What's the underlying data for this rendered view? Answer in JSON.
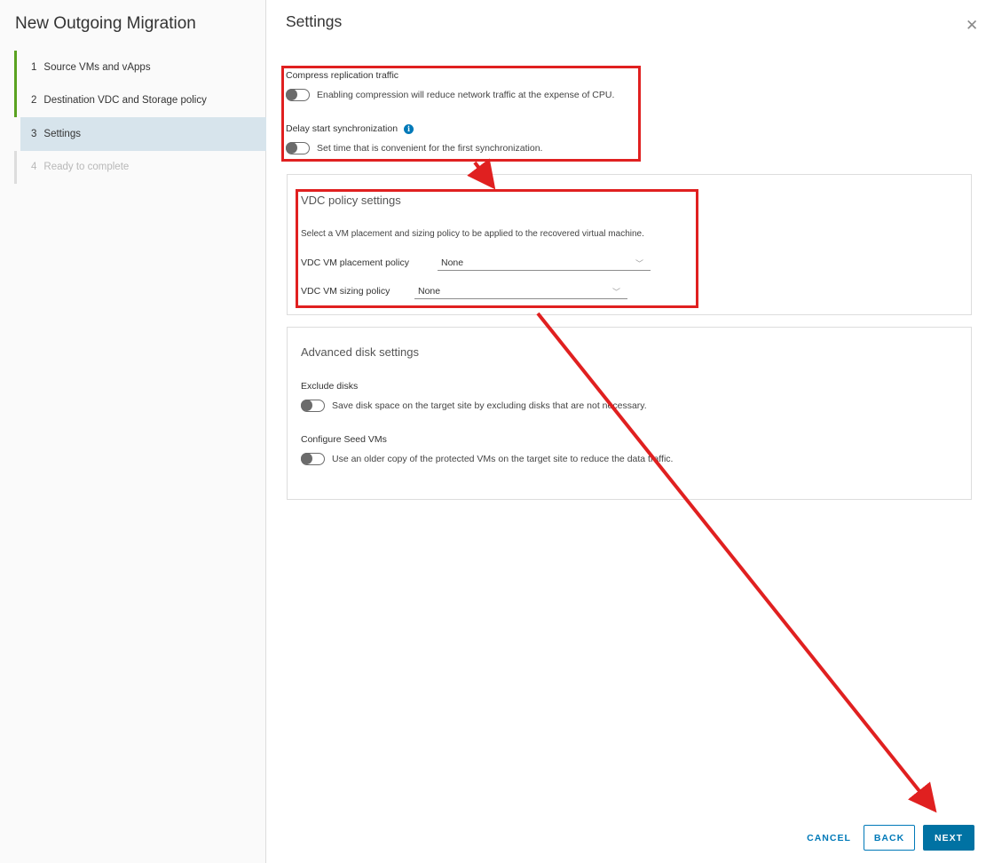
{
  "wizard": {
    "title": "New Outgoing Migration",
    "steps": [
      {
        "num": "1",
        "label": "Source VMs and vApps"
      },
      {
        "num": "2",
        "label": "Destination VDC and Storage policy"
      },
      {
        "num": "3",
        "label": "Settings"
      },
      {
        "num": "4",
        "label": "Ready to complete"
      }
    ]
  },
  "main": {
    "title": "Settings",
    "compress": {
      "label": "Compress replication traffic",
      "toggle_text": "Enabling compression will reduce network traffic at the expense of CPU."
    },
    "delay": {
      "label": "Delay start synchronization",
      "toggle_text": "Set time that is convenient for the first synchronization."
    },
    "vdc_policy": {
      "title": "VDC policy settings",
      "description": "Select a VM placement and sizing policy to be applied to the recovered virtual machine.",
      "placement_label": "VDC VM placement policy",
      "placement_value": "None",
      "sizing_label": "VDC VM sizing policy",
      "sizing_value": "None"
    },
    "advanced": {
      "title": "Advanced disk settings",
      "exclude_label": "Exclude disks",
      "exclude_text": "Save disk space on the target site by excluding disks that are not necessary.",
      "seed_label": "Configure Seed VMs",
      "seed_text": "Use an older copy of the protected VMs on the target site to reduce the data traffic."
    }
  },
  "footer": {
    "cancel": "CANCEL",
    "back": "BACK",
    "next": "NEXT"
  },
  "icons": {
    "close": "close-icon",
    "info": "info-icon",
    "chevron": "chevron-down-icon"
  },
  "colors": {
    "accent": "#0079b8",
    "primary_button": "#0072a3",
    "step_done": "#5aa220",
    "active_step_bg": "#d7e4ec",
    "annotation": "#e02020"
  }
}
